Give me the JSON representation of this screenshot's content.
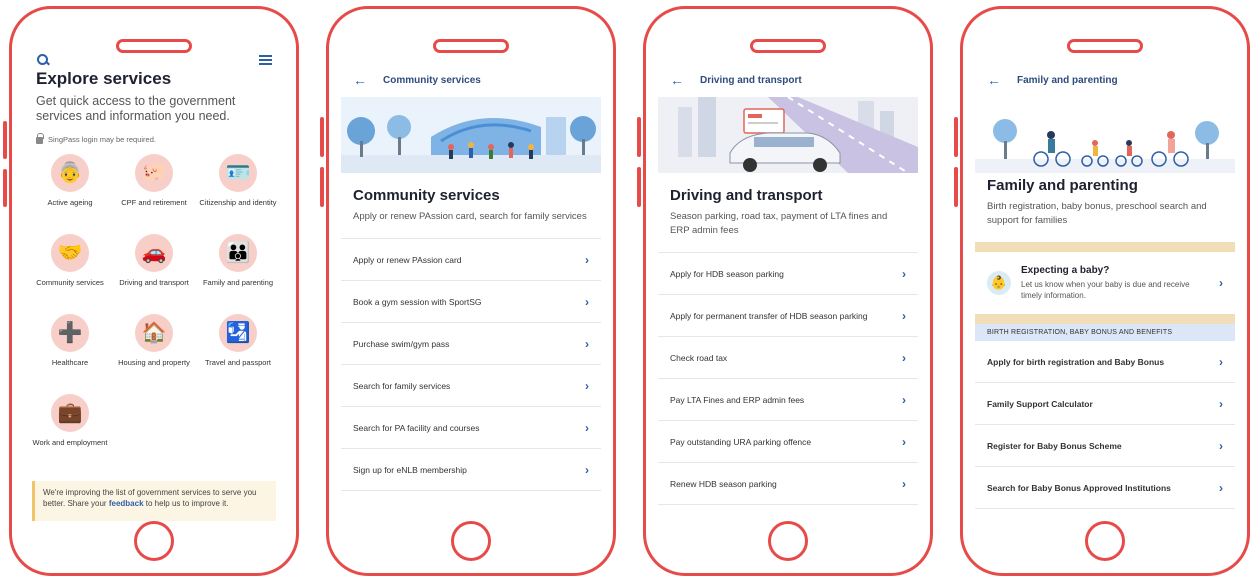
{
  "explore": {
    "title": "Explore services",
    "subtitle": "Get quick access to the government services and information you need.",
    "login_note": "SingPass login may be required.",
    "services": [
      {
        "label": "Active ageing",
        "glyph": "👵"
      },
      {
        "label": "CPF and retirement",
        "glyph": "🐖"
      },
      {
        "label": "Citizenship and identity",
        "glyph": "🪪"
      },
      {
        "label": "Community services",
        "glyph": "🤝"
      },
      {
        "label": "Driving and transport",
        "glyph": "🚗"
      },
      {
        "label": "Family and parenting",
        "glyph": "👪"
      },
      {
        "label": "Healthcare",
        "glyph": "➕"
      },
      {
        "label": "Housing and property",
        "glyph": "🏠"
      },
      {
        "label": "Travel and passport",
        "glyph": "🛂"
      },
      {
        "label": "Work and employment",
        "glyph": "💼"
      }
    ],
    "notice_text": "We're improving the list of government services to serve you better. Share your ",
    "notice_link": "feedback",
    "notice_end": " to help us to improve it."
  },
  "community": {
    "header": "Community services",
    "title": "Community services",
    "subtitle": "Apply or renew PAssion card, search for family services",
    "items": [
      "Apply or renew PAssion card",
      "Book a gym session with SportSG",
      "Purchase swim/gym pass",
      "Search for family services",
      "Search for PA facility and courses",
      "Sign up for eNLB membership"
    ]
  },
  "driving": {
    "header": "Driving and transport",
    "title": "Driving and transport",
    "subtitle": "Season parking, road tax, payment of LTA fines and ERP admin fees",
    "items": [
      "Apply for HDB season parking",
      "Apply for permanent transfer of HDB season parking",
      "Check road tax",
      "Pay LTA Fines and ERP admin fees",
      "Pay outstanding URA parking offence",
      "Renew HDB season parking"
    ]
  },
  "family": {
    "header": "Family and parenting",
    "title": "Family and parenting",
    "subtitle": "Birth registration, baby bonus, preschool search and support for families",
    "baby_title": "Expecting a baby?",
    "baby_sub": "Let us know when your baby is due and receive timely information.",
    "section": "BIRTH REGISTRATION, BABY BONUS AND BENEFITS",
    "items": [
      "Apply for birth registration and Baby Bonus",
      "Family Support Calculator",
      "Register for Baby Bonus Scheme",
      "Search for Baby Bonus Approved Institutions"
    ]
  },
  "icons": {
    "back": "arrow-left-icon",
    "chevron": "chevron-right-icon",
    "search": "search-icon",
    "menu": "hamburger-menu-icon",
    "lock": "lock-icon"
  },
  "colors": {
    "frame": "#e64b49",
    "accent": "#2d5fa8",
    "icon_bg": "#f7cfc8",
    "section_bg": "#dbe6f6",
    "notice_bg": "#fdf5e4"
  }
}
